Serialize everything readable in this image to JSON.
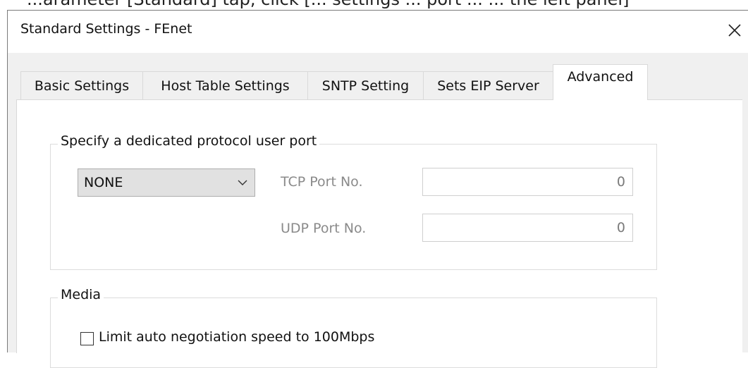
{
  "background": {
    "partial_text": "...arameter [Standard] tap, click [... settings ... port ... ... the left panel]"
  },
  "dialog": {
    "title": "Standard Settings - FEnet",
    "close_icon": "close-icon",
    "tabs": [
      {
        "label": "Basic Settings",
        "active": false
      },
      {
        "label": "Host Table Settings",
        "active": false
      },
      {
        "label": "SNTP Setting",
        "active": false
      },
      {
        "label": "Sets EIP Server",
        "active": false
      },
      {
        "label": "Advanced",
        "active": true
      }
    ],
    "protocol_group": {
      "legend": "Specify a dedicated protocol user port",
      "protocol_select": {
        "value": "NONE",
        "icon": "chevron-down-icon"
      },
      "tcp": {
        "label": "TCP Port No.",
        "value": "0"
      },
      "udp": {
        "label": "UDP Port No.",
        "value": "0"
      }
    },
    "media_group": {
      "legend": "Media",
      "limit_speed": {
        "label": "Limit auto negotiation speed to 100Mbps",
        "checked": false
      }
    }
  },
  "colors": {
    "dialog_bg": "#f0f0f0",
    "panel_bg": "#ffffff",
    "disabled_text": "#8a8a8a",
    "combo_bg": "#e1e1e1"
  }
}
